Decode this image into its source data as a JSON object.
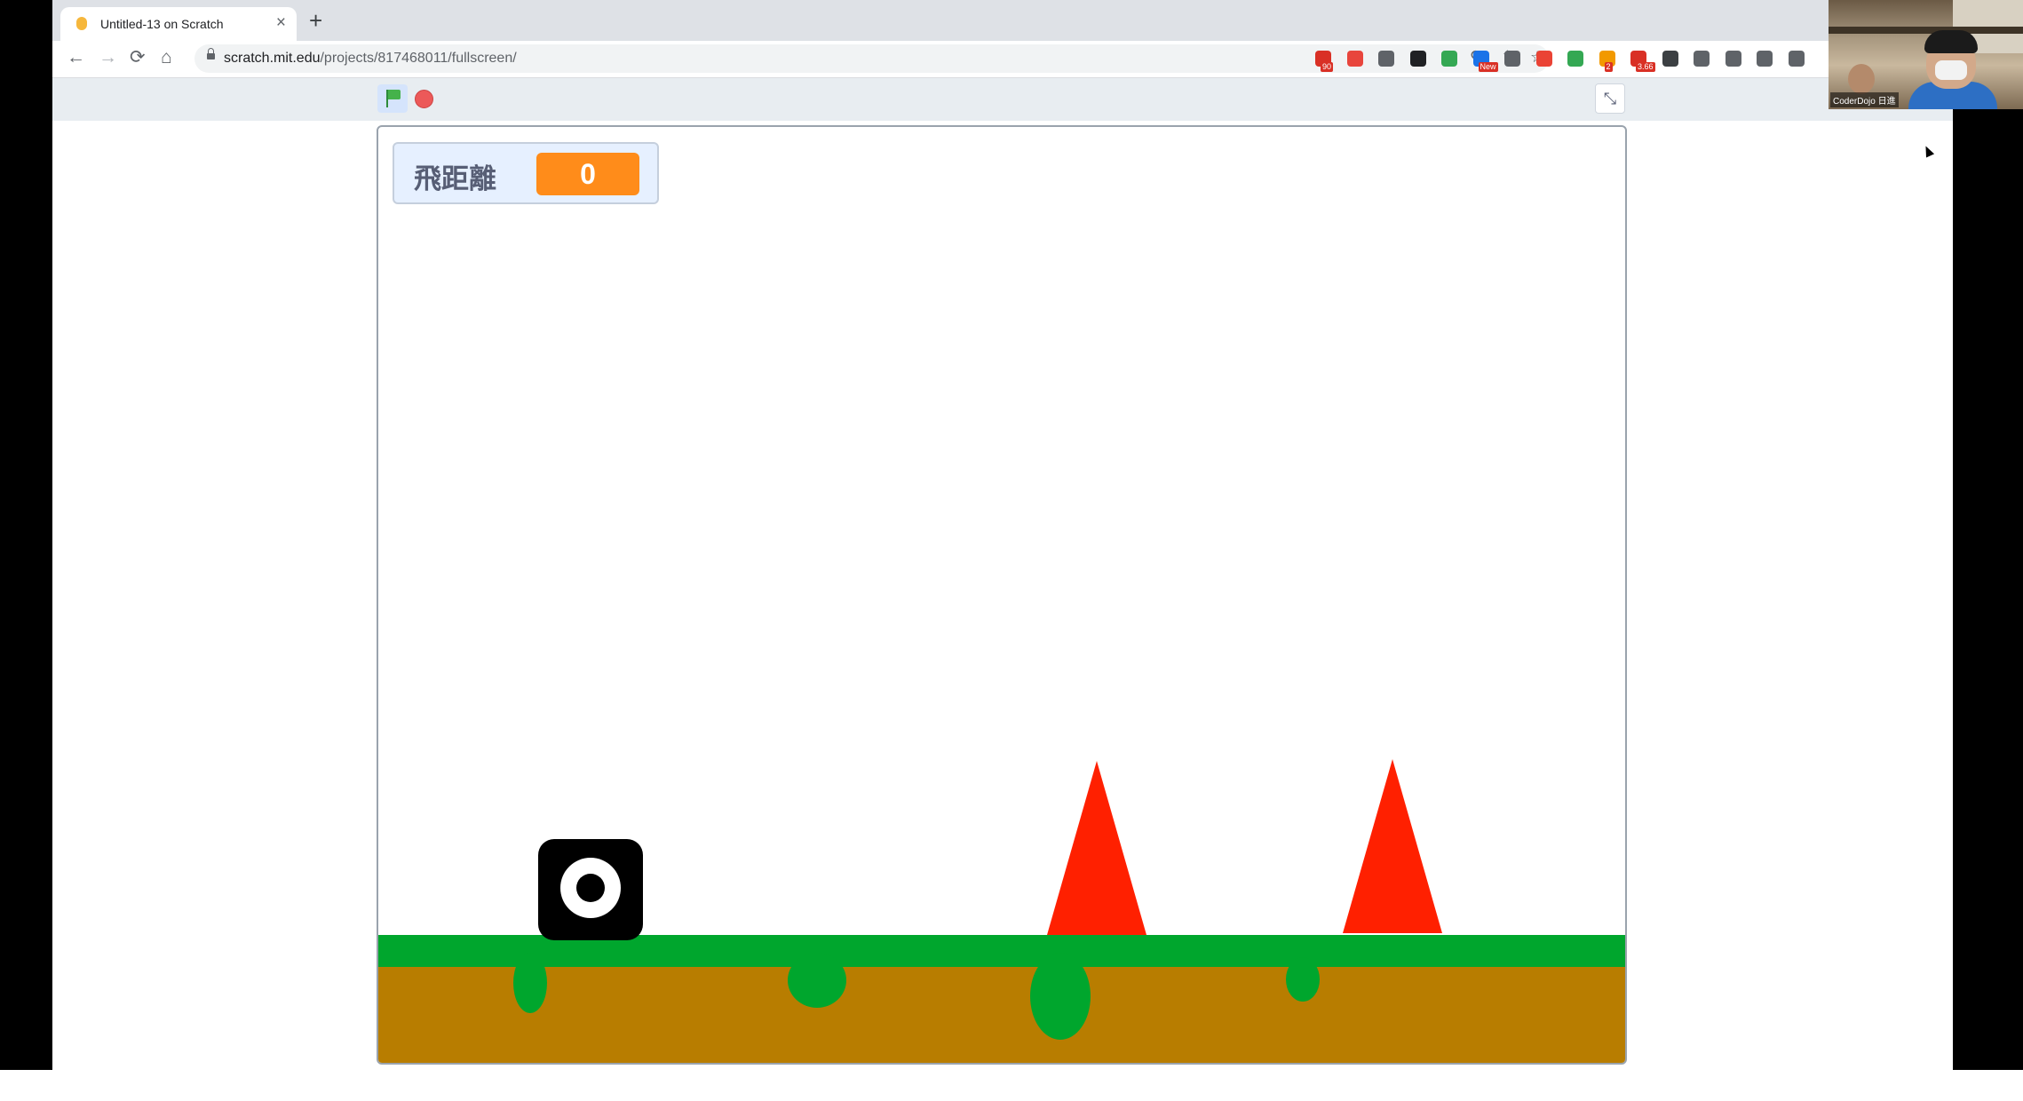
{
  "browser": {
    "tab": {
      "title": "Untitled-13 on Scratch",
      "close": "×"
    },
    "new_tab": "+",
    "nav": {
      "back": "←",
      "forward": "→",
      "reload": "⟳",
      "home": "⌂"
    },
    "address": {
      "host": "scratch.mit.edu",
      "path": "/projects/817468011/fullscreen/"
    },
    "icons": {
      "zoom": "⚲",
      "share": "⇪",
      "star": "☆"
    },
    "extensions": [
      {
        "name": "gmail-icon",
        "color": "#d93025",
        "badge": "90"
      },
      {
        "name": "adblock-icon",
        "color": "#e8453c",
        "badge": ""
      },
      {
        "name": "history-icon",
        "color": "#5f6368",
        "badge": ""
      },
      {
        "name": "binary-icon",
        "color": "#202124",
        "badge": ""
      },
      {
        "name": "maps-icon",
        "color": "#34a853",
        "badge": ""
      },
      {
        "name": "news-icon",
        "color": "#1a73e8",
        "badge": "New"
      },
      {
        "name": "settings-icon",
        "color": "#5f6368",
        "badge": ""
      },
      {
        "name": "shield-icon",
        "color": "#ea4335",
        "badge": ""
      },
      {
        "name": "diamond-icon",
        "color": "#34a853",
        "badge": ""
      },
      {
        "name": "orange-ext-icon",
        "color": "#f29900",
        "badge": "2"
      },
      {
        "name": "counter-icon",
        "color": "#d93025",
        "badge": "3.66"
      },
      {
        "name": "qr-icon",
        "color": "#3c4043",
        "badge": ""
      },
      {
        "name": "grid-icon",
        "color": "#5f6368",
        "badge": ""
      },
      {
        "name": "check-icon",
        "color": "#5f6368",
        "badge": ""
      },
      {
        "name": "vpn-icon",
        "color": "#5f6368",
        "badge": ""
      },
      {
        "name": "camera-icon",
        "color": "#5f6368",
        "badge": ""
      }
    ]
  },
  "scratch": {
    "fullscreen_icon": "⤡",
    "monitor": {
      "label": "飛距離",
      "value": "0"
    },
    "colors": {
      "grass": "#00a62d",
      "dirt": "#b87d00",
      "spike": "#ff2000",
      "monitor_value": "#ff8c1a"
    }
  },
  "webcam": {
    "caption": "CoderDojo 日進"
  }
}
